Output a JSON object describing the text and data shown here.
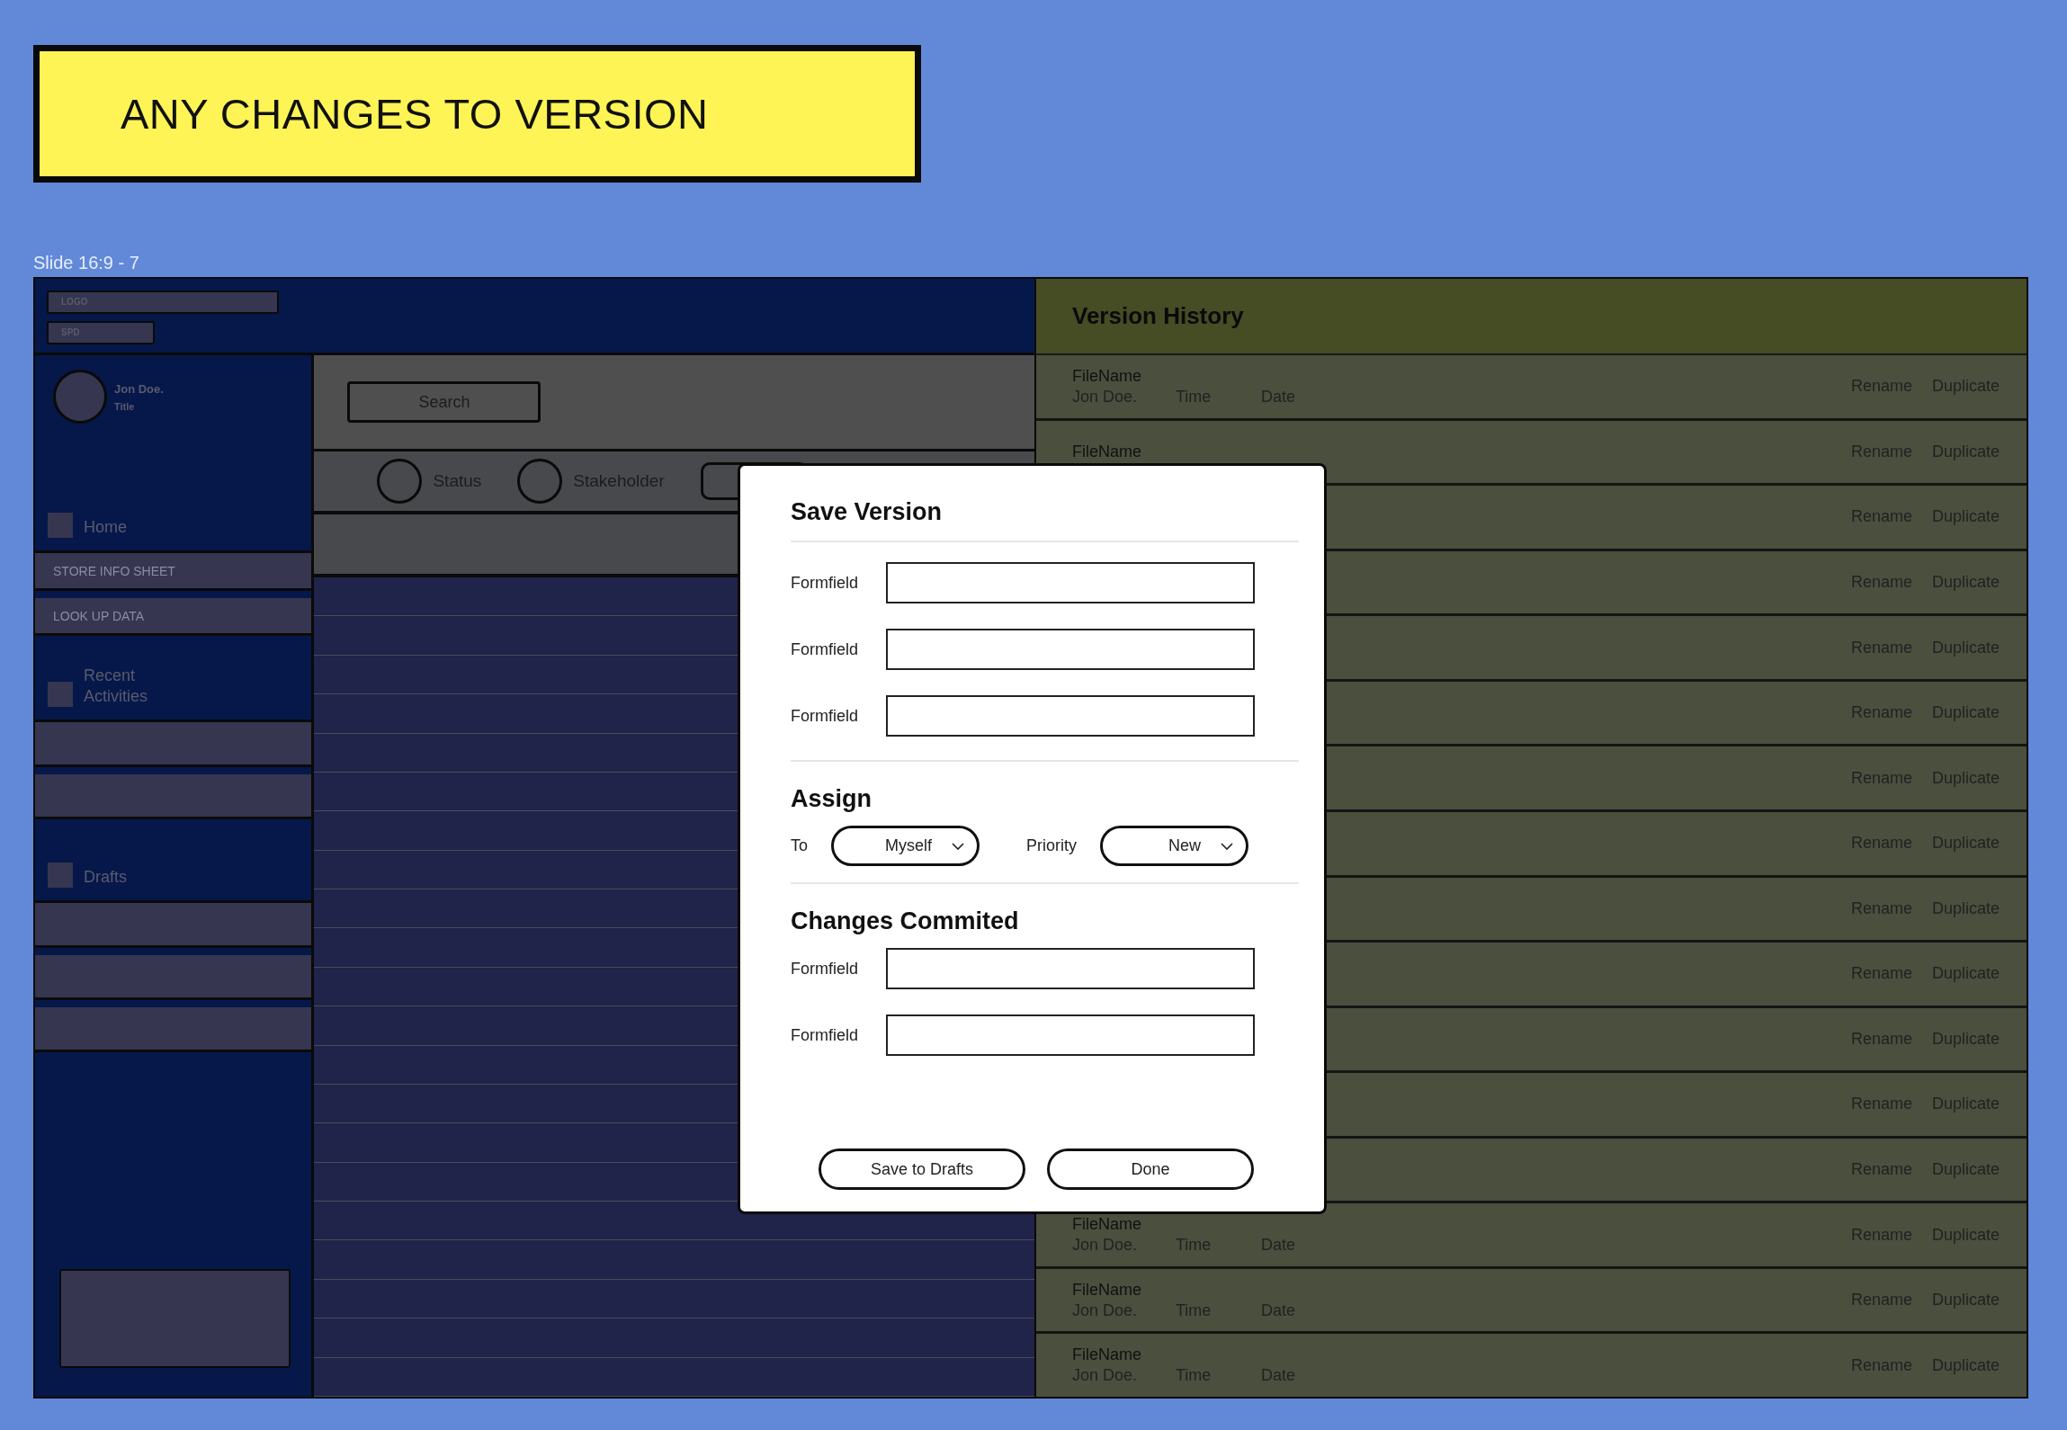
{
  "banner": {
    "text": "ANY CHANGES TO VERSION"
  },
  "frame_label": "Slide 16:9 - 7",
  "header": {
    "logo": "LOGO",
    "subtitle": "SPD"
  },
  "user": {
    "name": "Jon Doe.",
    "title": "Title"
  },
  "sidebar": {
    "items": [
      {
        "kind": "section",
        "label": "Home"
      },
      {
        "kind": "link",
        "label": "STORE INFO SHEET"
      },
      {
        "kind": "link",
        "label": "LOOK UP DATA"
      },
      {
        "kind": "section",
        "label": "Recent Activities"
      },
      {
        "kind": "link"
      },
      {
        "kind": "link"
      },
      {
        "kind": "section",
        "label": "Drafts"
      },
      {
        "kind": "link"
      },
      {
        "kind": "link"
      },
      {
        "kind": "link"
      }
    ]
  },
  "main": {
    "search": "Search",
    "filters": [
      {
        "label": "Status",
        "selected": false
      },
      {
        "label": "Stakeholder",
        "selected": false
      }
    ]
  },
  "version_history": {
    "title": "Version History",
    "rows": [
      {
        "file": "FileName",
        "author": "Jon Doe.",
        "time": "Time",
        "date": "Date",
        "actions": [
          "Rename",
          "Duplicate"
        ]
      },
      {
        "file": "FileName",
        "actions": [
          "Rename",
          "Duplicate"
        ]
      },
      {
        "actions": [
          "Rename",
          "Duplicate"
        ]
      },
      {
        "actions": [
          "Rename",
          "Duplicate"
        ]
      },
      {
        "actions": [
          "Rename",
          "Duplicate"
        ]
      },
      {
        "actions": [
          "Rename",
          "Duplicate"
        ]
      },
      {
        "actions": [
          "Rename",
          "Duplicate"
        ]
      },
      {
        "actions": [
          "Rename",
          "Duplicate"
        ]
      },
      {
        "actions": [
          "Rename",
          "Duplicate"
        ]
      },
      {
        "actions": [
          "Rename",
          "Duplicate"
        ]
      },
      {
        "actions": [
          "Rename",
          "Duplicate"
        ]
      },
      {
        "actions": [
          "Rename",
          "Duplicate"
        ]
      },
      {
        "actions": [
          "Rename",
          "Duplicate"
        ]
      },
      {
        "file": "FileName",
        "author": "Jon Doe.",
        "time": "Time",
        "date": "Date",
        "actions": [
          "Rename",
          "Duplicate"
        ]
      },
      {
        "file": "FileName",
        "author": "Jon Doe.",
        "time": "Time",
        "date": "Date",
        "actions": [
          "Rename",
          "Duplicate"
        ]
      },
      {
        "file": "FileName",
        "author": "Jon Doe.",
        "time": "Time",
        "date": "Date",
        "actions": [
          "Rename",
          "Duplicate"
        ]
      }
    ]
  },
  "dialog": {
    "title": "Save Version",
    "sections": [
      {
        "kind": "fields",
        "fields": [
          {
            "label": "Formfield"
          },
          {
            "label": "Formfield"
          },
          {
            "label": "Formfield"
          }
        ]
      },
      {
        "kind": "selects",
        "title": "Assign",
        "selects": [
          {
            "label": "To",
            "value": "Myself"
          },
          {
            "label": "Priority",
            "value": "New"
          }
        ]
      },
      {
        "kind": "fields",
        "title": "Changes Commited",
        "fields": [
          {
            "label": "Formfield"
          },
          {
            "label": "Formfield"
          }
        ]
      }
    ],
    "buttons": [
      "Save to Drafts",
      "Done"
    ]
  }
}
